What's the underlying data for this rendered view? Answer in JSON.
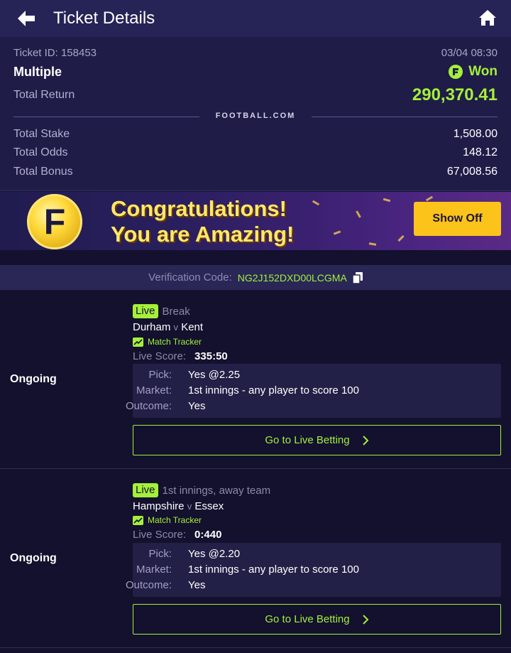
{
  "header": {
    "title": "Ticket Details"
  },
  "summary": {
    "ticket_id_label": "Ticket ID: 158453",
    "datetime": "03/04 08:30",
    "bet_type": "Multiple",
    "status": "Won",
    "total_return_label": "Total Return",
    "total_return_value": "290,370.41",
    "brand": "FOOTBALL.COM",
    "rows": [
      {
        "label": "Total Stake",
        "value": "1,508.00"
      },
      {
        "label": "Total Odds",
        "value": "148.12"
      },
      {
        "label": "Total Bonus",
        "value": "67,008.56"
      }
    ]
  },
  "banner": {
    "logo_letter": "F",
    "line1": "Congratulations!",
    "line2": "You are Amazing!",
    "button": "Show Off"
  },
  "verification": {
    "label": "Verification Code:",
    "code": "NG2J152DXD00LCGMA"
  },
  "selections": [
    {
      "status": "Ongoing",
      "live_label": "Live",
      "live_note": "Break",
      "home": "Durham",
      "vs": "v",
      "away": "Kent",
      "tracker": "Match Tracker",
      "score_label": "Live Score:",
      "score": "335:50",
      "pick_label": "Pick:",
      "pick": "Yes @2.25",
      "market_label": "Market:",
      "market": "1st innings - any player to score 100",
      "outcome_label": "Outcome:",
      "outcome": "Yes",
      "button": "Go to Live Betting"
    },
    {
      "status": "Ongoing",
      "live_label": "Live",
      "live_note": "1st innings, away team",
      "home": "Hampshire",
      "vs": "v",
      "away": "Essex",
      "tracker": "Match Tracker",
      "score_label": "Live Score:",
      "score": "0:440",
      "pick_label": "Pick:",
      "pick": "Yes @2.20",
      "market_label": "Market:",
      "market": "1st innings - any player to score 100",
      "outcome_label": "Outcome:",
      "outcome": "Yes",
      "button": "Go to Live Betting"
    }
  ],
  "colors": {
    "accent": "#a4f03a",
    "header_bg": "#262357",
    "page_bg": "#13112e",
    "button_yellow": "#fcc31a"
  },
  "icons": [
    "back-arrow-icon",
    "home-icon",
    "won-badge-icon",
    "copy-icon",
    "match-tracker-icon",
    "chevron-right-icon"
  ]
}
